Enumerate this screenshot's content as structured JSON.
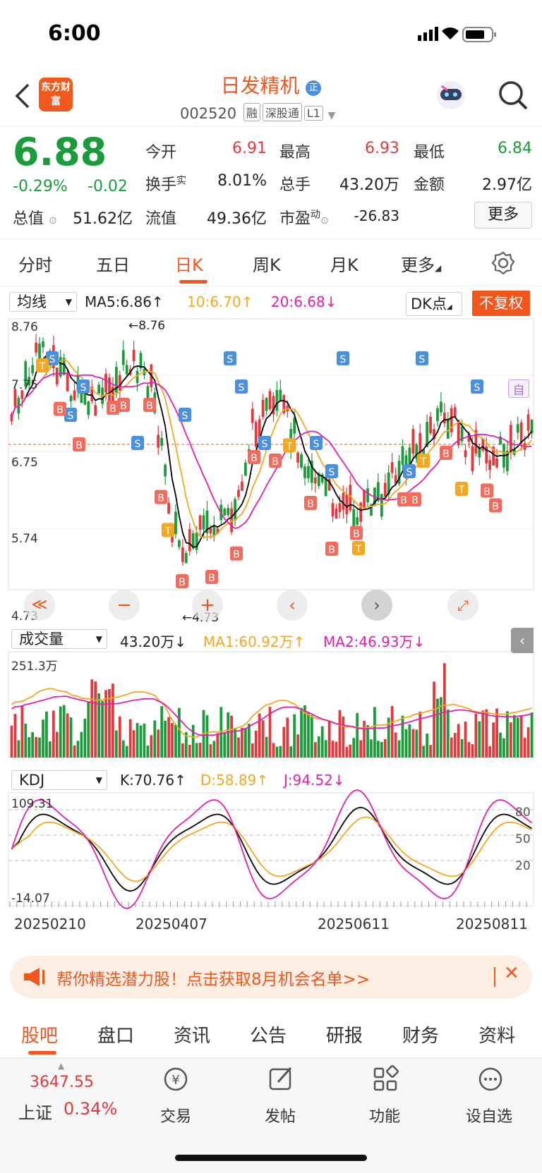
{
  "status": {
    "time": "6:00"
  },
  "header": {
    "logo": "东方财富",
    "name": "日发精机",
    "code": "002520",
    "tags": [
      "融",
      "深股通",
      "L1"
    ]
  },
  "quote": {
    "price": "6.88",
    "pct": "-0.29%",
    "chg": "-0.02",
    "open_l": "今开",
    "open_v": "6.91",
    "high_l": "最高",
    "high_v": "6.93",
    "low_l": "最低",
    "low_v": "6.84",
    "turn_l": "换手",
    "turn_sup": "实",
    "turn_v": "8.01%",
    "vol_l": "总手",
    "vol_v": "43.20万",
    "amt_l": "金额",
    "amt_v": "2.97亿",
    "mcap_l": "总值",
    "mcap_v": "51.62亿",
    "float_l": "流值",
    "float_v": "49.36亿",
    "pe_l": "市盈",
    "pe_sup": "动",
    "pe_v": "-26.83",
    "more": "更多"
  },
  "tabs": [
    "分时",
    "五日",
    "日K",
    "周K",
    "月K",
    "更多"
  ],
  "kline": {
    "ma_select": "均线",
    "ma5": "MA5:6.86↑",
    "ma10": "10:6.70↑",
    "ma20": "20:6.68↓",
    "dk": "DK点",
    "fq": "不复权",
    "ymax": "8.76",
    "y2": "7.75",
    "y3": "6.75",
    "y4": "5.74",
    "ymin": "4.73",
    "hi_mark": "←8.76",
    "lo_mark": "←4.73",
    "self": "自"
  },
  "volume": {
    "select": "成交量",
    "vol": "43.20万↓",
    "ma1": "MA1:60.92万↑",
    "ma2": "MA2:46.93万↓",
    "ymax": "251.3万"
  },
  "kdj": {
    "select": "KDJ",
    "k": "K:70.76↑",
    "d": "D:58.89↑",
    "j": "J:94.52↓",
    "ymax": "109.31",
    "ymin": "-14.07",
    "l80": "80",
    "l50": "50",
    "l20": "20"
  },
  "dates": [
    "20250210",
    "20250407",
    "20250611",
    "20250811"
  ],
  "ad": {
    "text": "帮你精选潜力股！点击获取8月机会名单>>"
  },
  "bottom_tabs": [
    "股吧",
    "盘口",
    "资讯",
    "公告",
    "研报",
    "财务",
    "资料"
  ],
  "index": {
    "value": "3647.55",
    "name": "上证",
    "pct": "0.34%"
  },
  "bottom_nav": [
    "交易",
    "发帖",
    "功能",
    "设自选"
  ],
  "colors": {
    "up": "#e4393c",
    "down": "#1a9c3b",
    "accent": "#f2561d",
    "ma5": "#000000",
    "ma10": "#f5a623",
    "ma20": "#e020b0"
  }
}
